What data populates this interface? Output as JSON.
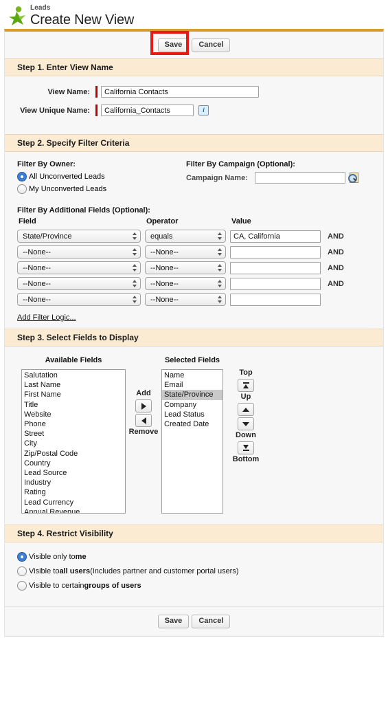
{
  "header": {
    "breadcrumb": "Leads",
    "title": "Create New View",
    "icon": "leads-person-icon"
  },
  "toolbar_top": {
    "save_label": "Save",
    "cancel_label": "Cancel"
  },
  "toolbar_bottom": {
    "save_label": "Save",
    "cancel_label": "Cancel"
  },
  "step1": {
    "heading": "Step 1. Enter View Name",
    "view_name_label": "View Name:",
    "view_name_value": "California Contacts",
    "view_unique_name_label": "View Unique Name:",
    "view_unique_name_value": "California_Contacts",
    "info_icon": "info-icon",
    "info_glyph": "i"
  },
  "step2": {
    "heading": "Step 2. Specify Filter Criteria",
    "filter_by_owner_label": "Filter By Owner:",
    "owner_options": [
      {
        "label": "All Unconverted Leads",
        "selected": true
      },
      {
        "label": "My Unconverted Leads",
        "selected": false
      }
    ],
    "filter_by_campaign_label": "Filter By Campaign (Optional):",
    "campaign_name_label": "Campaign Name:",
    "campaign_name_value": "",
    "campaign_lookup_icon": "lookup-magnifier-icon",
    "additional_fields_label": "Filter By Additional Fields (Optional):",
    "columns": {
      "field": "Field",
      "operator": "Operator",
      "value": "Value"
    },
    "and_label": "AND",
    "none_option": "--None--",
    "rows": [
      {
        "field": "State/Province",
        "operator": "equals",
        "value": "CA, California",
        "conjunction": "AND"
      },
      {
        "field": "--None--",
        "operator": "--None--",
        "value": "",
        "conjunction": "AND"
      },
      {
        "field": "--None--",
        "operator": "--None--",
        "value": "",
        "conjunction": "AND"
      },
      {
        "field": "--None--",
        "operator": "--None--",
        "value": "",
        "conjunction": "AND"
      },
      {
        "field": "--None--",
        "operator": "--None--",
        "value": "",
        "conjunction": ""
      }
    ],
    "add_filter_logic": "Add Filter Logic..."
  },
  "step3": {
    "heading": "Step 3. Select Fields to Display",
    "available_label": "Available Fields",
    "selected_label": "Selected Fields",
    "available_fields": [
      "Salutation",
      "Last Name",
      "First Name",
      "Title",
      "Website",
      "Phone",
      "Street",
      "City",
      "Zip/Postal Code",
      "Country",
      "Lead Source",
      "Industry",
      "Rating",
      "Lead Currency",
      "Annual Revenue"
    ],
    "selected_fields": [
      {
        "label": "Name",
        "highlighted": false
      },
      {
        "label": "Email",
        "highlighted": false
      },
      {
        "label": "State/Province",
        "highlighted": true
      },
      {
        "label": "Company",
        "highlighted": false
      },
      {
        "label": "Lead Status",
        "highlighted": false
      },
      {
        "label": "Created Date",
        "highlighted": false
      }
    ],
    "add_label": "Add",
    "remove_label": "Remove",
    "top_label": "Top",
    "up_label": "Up",
    "down_label": "Down",
    "bottom_label": "Bottom"
  },
  "step4": {
    "heading": "Step 4. Restrict Visibility",
    "options": [
      {
        "pre": "Visible only to ",
        "strong": "me",
        "post": "",
        "selected": true
      },
      {
        "pre": "Visible to ",
        "strong": "all users",
        "post": " (Includes partner and customer portal users)",
        "selected": false
      },
      {
        "pre": "Visible to certain ",
        "strong": "groups of users",
        "post": "",
        "selected": false
      }
    ]
  },
  "colors": {
    "accent_border": "#d89b28",
    "section_header_bg": "#fbebd2",
    "panel_bg": "#f7f7f7",
    "required_marker": "#c00000",
    "highlight_box": "#e41b17",
    "radio_selected": "#3b7fd4",
    "list_selection": "#c9c9c9"
  }
}
